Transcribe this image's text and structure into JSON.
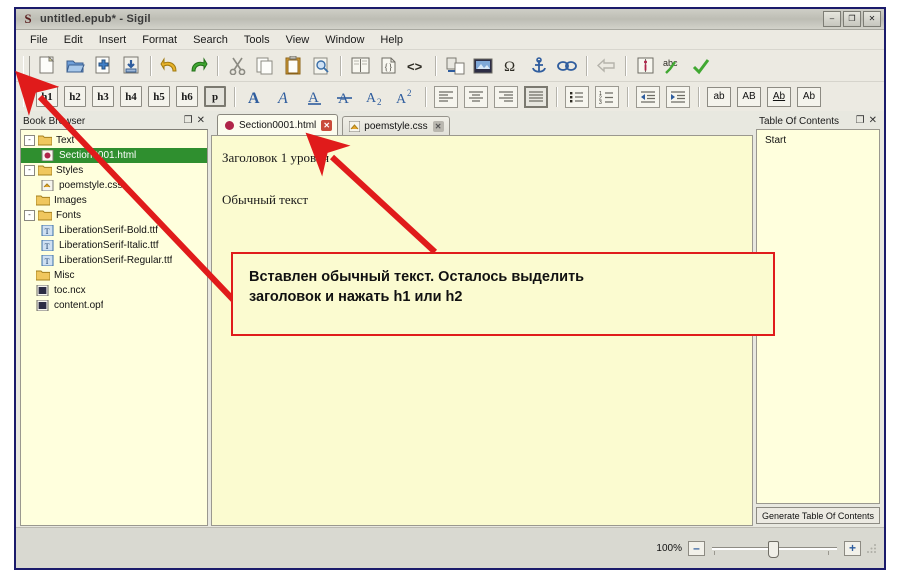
{
  "window": {
    "title": "untitled.epub* - Sigil",
    "logo": "sigil-logo",
    "minimize": "–",
    "maximize": "❐",
    "close": "✕"
  },
  "menu": {
    "items": [
      "File",
      "Edit",
      "Insert",
      "Format",
      "Search",
      "Tools",
      "View",
      "Window",
      "Help"
    ]
  },
  "toolbar_main": {
    "items": [
      {
        "name": "new-file-icon",
        "title": "New"
      },
      {
        "name": "open-file-icon",
        "title": "Open"
      },
      {
        "name": "add-file-icon",
        "title": "Add Existing Files"
      },
      {
        "name": "save-icon",
        "title": "Save"
      },
      {
        "name": "undo-icon",
        "title": "Undo"
      },
      {
        "name": "redo-icon",
        "title": "Redo"
      },
      {
        "name": "cut-icon",
        "title": "Cut"
      },
      {
        "name": "copy-icon",
        "title": "Copy"
      },
      {
        "name": "paste-icon",
        "title": "Paste"
      },
      {
        "name": "find-replace-icon",
        "title": "Find & Replace"
      },
      {
        "name": "book-view-icon",
        "title": "Book View"
      },
      {
        "name": "split-view-icon",
        "title": "Split View"
      },
      {
        "name": "code-view-icon",
        "title": "Code View"
      },
      {
        "name": "split-at-cursor-icon",
        "title": "Split At Cursor"
      },
      {
        "name": "insert-image-icon",
        "title": "Insert Image"
      },
      {
        "name": "insert-special-character-icon",
        "title": "Insert Special Character"
      },
      {
        "name": "insert-anchor-icon",
        "title": "Insert Anchor"
      },
      {
        "name": "insert-link-icon",
        "title": "Insert Link"
      },
      {
        "name": "back-icon",
        "title": "Back"
      },
      {
        "name": "metadata-editor-icon",
        "title": "Metadata Editor"
      },
      {
        "name": "spellcheck-icon",
        "title": "Spellcheck"
      },
      {
        "name": "validate-icon",
        "title": "Validate EPUB"
      }
    ]
  },
  "toolbar_format": {
    "headings": [
      {
        "label": "h1",
        "active": false
      },
      {
        "label": "h2",
        "active": false
      },
      {
        "label": "h3",
        "active": false
      },
      {
        "label": "h4",
        "active": false
      },
      {
        "label": "h5",
        "active": false
      },
      {
        "label": "h6",
        "active": false
      },
      {
        "label": "p",
        "active": true
      }
    ],
    "styles": [
      {
        "name": "bold-icon",
        "glyph": "A"
      },
      {
        "name": "italic-icon",
        "glyph": "A"
      },
      {
        "name": "underline-icon",
        "glyph": "A"
      },
      {
        "name": "strikethrough-icon",
        "glyph": "A"
      },
      {
        "name": "subscript-icon",
        "glyph": "A"
      },
      {
        "name": "superscript-icon",
        "glyph": "A"
      }
    ],
    "align": [
      {
        "name": "align-left-icon",
        "active": false
      },
      {
        "name": "align-center-icon",
        "active": false
      },
      {
        "name": "align-right-icon",
        "active": false
      },
      {
        "name": "align-justify-icon",
        "active": true
      }
    ],
    "lists": [
      {
        "name": "bullet-list-icon"
      },
      {
        "name": "numbered-list-icon"
      }
    ],
    "indent": [
      {
        "name": "outdent-icon"
      },
      {
        "name": "indent-icon"
      }
    ],
    "case_buttons": [
      {
        "name": "lowercase-button",
        "label": "ab"
      },
      {
        "name": "uppercase-button",
        "label": "AB"
      },
      {
        "name": "titlecase-button",
        "label": "Ab"
      },
      {
        "name": "capitalize-button",
        "label": "Ab"
      }
    ]
  },
  "book_browser": {
    "title": "Book Browser",
    "float_icon": "❐",
    "close_icon": "✕",
    "tree": [
      {
        "label": "Text",
        "type": "folder",
        "level": 0,
        "expander": "-",
        "selected": false
      },
      {
        "label": "Section0001.html",
        "type": "html",
        "level": 1,
        "expander": "",
        "selected": true
      },
      {
        "label": "Styles",
        "type": "folder",
        "level": 0,
        "expander": "-",
        "selected": false
      },
      {
        "label": "poemstyle.css",
        "type": "css",
        "level": 1,
        "expander": "",
        "selected": false
      },
      {
        "label": "Images",
        "type": "folder",
        "level": 0,
        "expander": "",
        "selected": false
      },
      {
        "label": "Fonts",
        "type": "folder",
        "level": 0,
        "expander": "-",
        "selected": false
      },
      {
        "label": "LiberationSerif-Bold.ttf",
        "type": "font",
        "level": 1,
        "expander": "",
        "selected": false
      },
      {
        "label": "LiberationSerif-Italic.ttf",
        "type": "font",
        "level": 1,
        "expander": "",
        "selected": false
      },
      {
        "label": "LiberationSerif-Regular.ttf",
        "type": "font",
        "level": 1,
        "expander": "",
        "selected": false
      },
      {
        "label": "Misc",
        "type": "folder",
        "level": 0,
        "expander": "",
        "selected": false
      },
      {
        "label": "toc.ncx",
        "type": "xml",
        "level": 0,
        "expander": "",
        "selected": false
      },
      {
        "label": "content.opf",
        "type": "xml",
        "level": 0,
        "expander": "",
        "selected": false
      }
    ]
  },
  "editor": {
    "tabs": [
      {
        "label": "Section0001.html",
        "active": true,
        "close": "✕",
        "icon": "html-icon"
      },
      {
        "label": "poemstyle.css",
        "active": false,
        "close": "✕",
        "icon": "css-icon"
      }
    ],
    "heading": "Заголовок 1 уровня",
    "paragraph": "Обычный текст"
  },
  "toc": {
    "title": "Table Of Contents",
    "float_icon": "❐",
    "close_icon": "✕",
    "entries": [
      "Start"
    ],
    "generate_button": "Generate Table Of Contents"
  },
  "status": {
    "zoom_value": "100%",
    "zoom_out": "–",
    "zoom_in": "+",
    "slider_position_pct": 50
  },
  "annotation": {
    "callout_line1": "Вставлен обычный текст. Осталось выделить",
    "callout_line2": "заголовок и нажать h1 или h2",
    "arrow_color": "#e01b1b",
    "arrow_to_h1": "arrow-pointing-to-h1-button",
    "arrow_to_heading": "arrow-pointing-to-heading-text"
  }
}
